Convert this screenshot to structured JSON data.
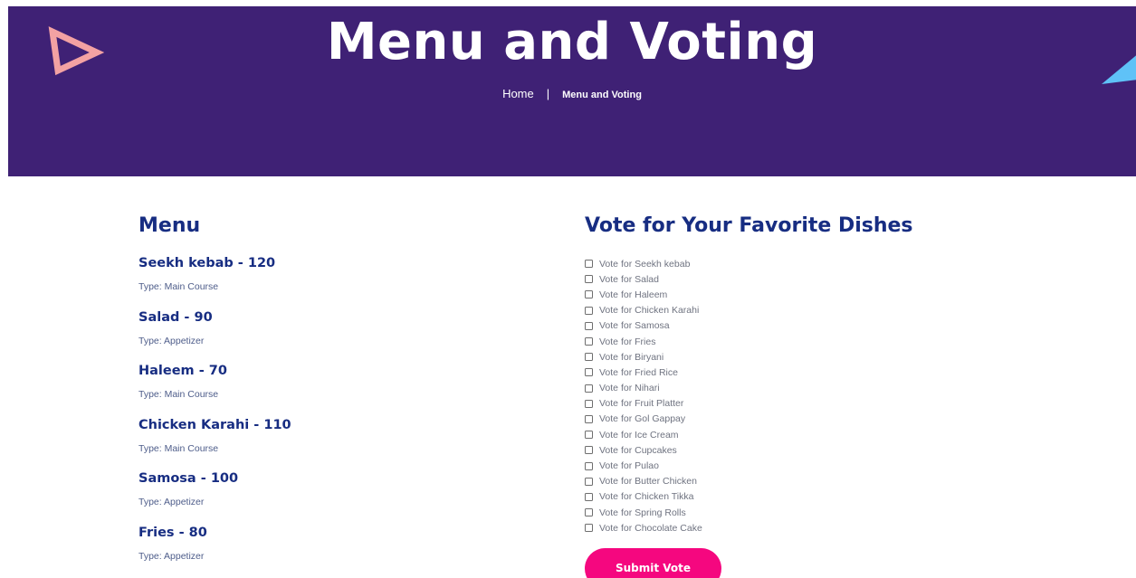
{
  "hero": {
    "title": "Menu and Voting",
    "breadcrumb": {
      "home": "Home",
      "separator": "|",
      "current": "Menu and Voting"
    },
    "colors": {
      "background": "#3f2175",
      "triangle_left": "#f3a2a3",
      "triangle_right": "#5fc2f7"
    }
  },
  "menu": {
    "title": "Menu",
    "items": [
      {
        "name": "Seekh kebab - 120",
        "type": "Type: Main Course"
      },
      {
        "name": "Salad - 90",
        "type": "Type: Appetizer"
      },
      {
        "name": "Haleem - 70",
        "type": "Type: Main Course"
      },
      {
        "name": "Chicken Karahi - 110",
        "type": "Type: Main Course"
      },
      {
        "name": "Samosa - 100",
        "type": "Type: Appetizer"
      },
      {
        "name": "Fries - 80",
        "type": "Type: Appetizer"
      }
    ]
  },
  "vote": {
    "title": "Vote for Your Favorite Dishes",
    "options": [
      "Vote for Seekh kebab",
      "Vote for Salad",
      "Vote for Haleem",
      "Vote for Chicken Karahi",
      "Vote for Samosa",
      "Vote for Fries",
      "Vote for Biryani",
      "Vote for Fried Rice",
      "Vote for Nihari",
      "Vote for Fruit Platter",
      "Vote for Gol Gappay",
      "Vote for Ice Cream",
      "Vote for Cupcakes",
      "Vote for Pulao",
      "Vote for Butter Chicken",
      "Vote for Chicken Tikka",
      "Vote for Spring Rolls",
      "Vote for Chocolate Cake"
    ],
    "submit_label": "Submit Vote",
    "colors": {
      "submit": "#f5077f",
      "heading": "#172d82"
    }
  }
}
